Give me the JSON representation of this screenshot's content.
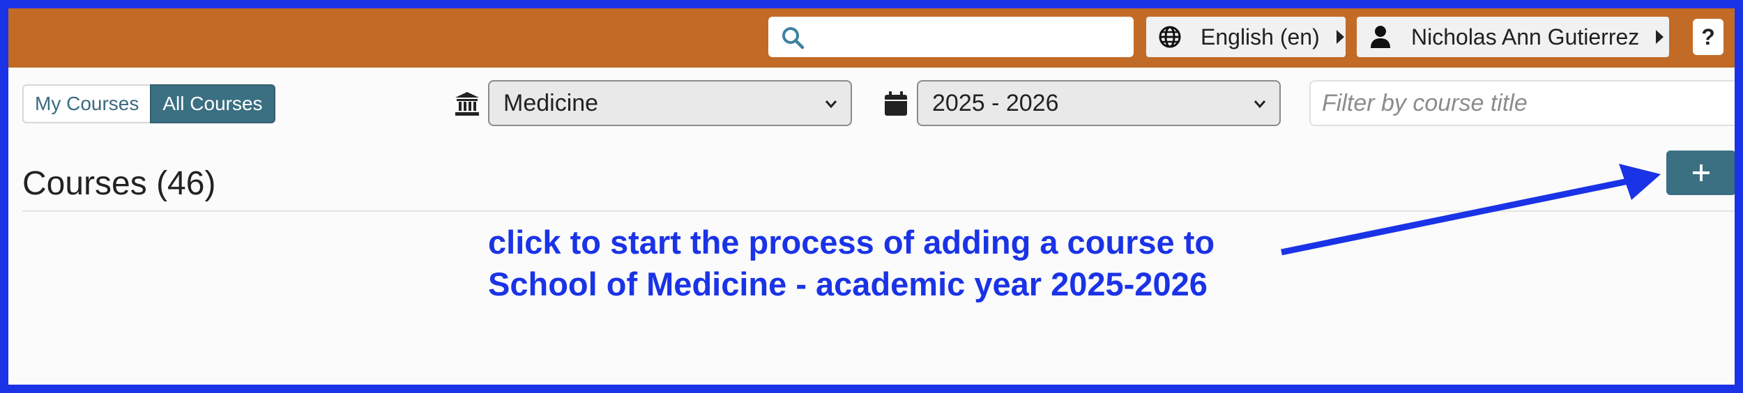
{
  "header": {
    "search": {
      "placeholder": ""
    },
    "language": {
      "label": "English (en)"
    },
    "user": {
      "name": "Nicholas Ann Gutierrez"
    },
    "help": {
      "label": "?"
    }
  },
  "toolbar": {
    "my_courses_label": "My Courses",
    "all_courses_label": "All Courses",
    "school_select": {
      "value": "Medicine"
    },
    "year_select": {
      "value": "2025 - 2026"
    },
    "filter": {
      "placeholder": "Filter by course title"
    }
  },
  "main": {
    "title": "Courses (46)",
    "add_button": {
      "label": "+"
    }
  },
  "annotation": {
    "line1": "click to start the process of adding a course to",
    "line2": "School of Medicine - academic year 2025-2026"
  },
  "colors": {
    "header": "#c26b26",
    "accent": "#3b6f82",
    "annotation": "#1a33e6"
  }
}
